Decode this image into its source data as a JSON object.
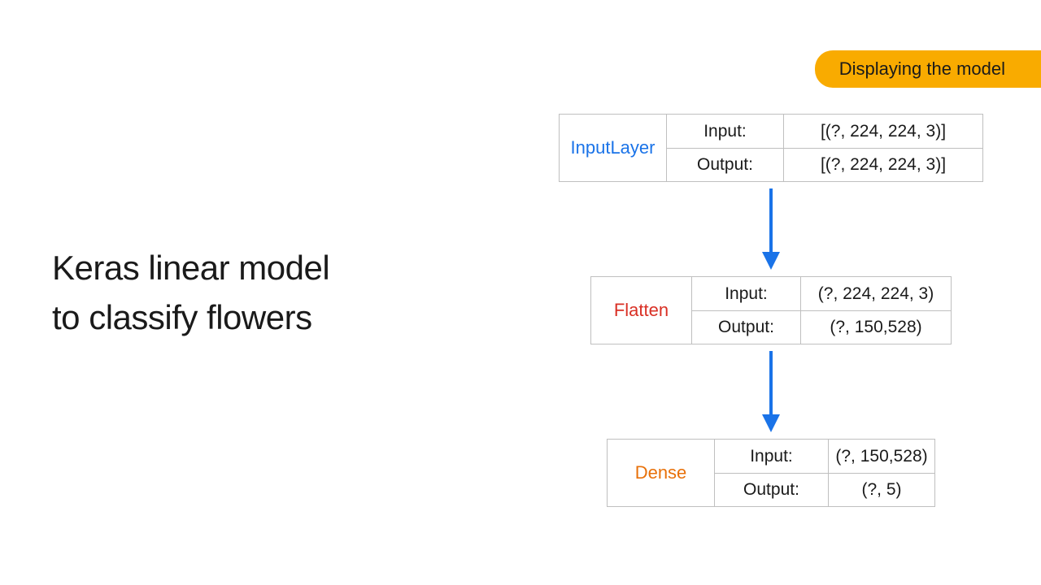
{
  "badge": "Displaying the model",
  "title_line1": "Keras linear model",
  "title_line2": "to classify flowers",
  "labels": {
    "input": "Input:",
    "output": "Output:"
  },
  "layers": [
    {
      "name": "InputLayer",
      "input": "[(?, 224, 224, 3)]",
      "output": "[(?, 224, 224, 3)]"
    },
    {
      "name": "Flatten",
      "input": "(?, 224, 224, 3)",
      "output": "(?, 150,528)"
    },
    {
      "name": "Dense",
      "input": "(?, 150,528)",
      "output": "(?, 5)"
    }
  ],
  "colors": {
    "badge_bg": "#f9ab00",
    "arrow": "#1a73e8",
    "input_layer": "#1a73e8",
    "flatten_layer": "#d93025",
    "dense_layer": "#e8710a"
  }
}
